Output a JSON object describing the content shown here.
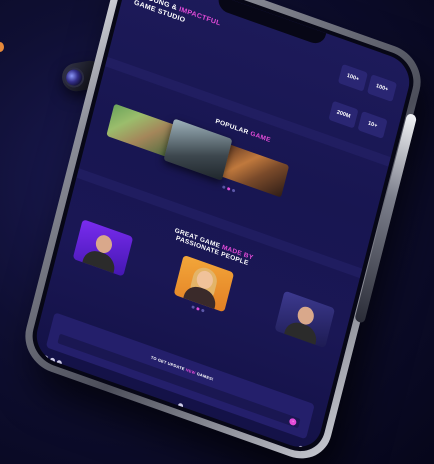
{
  "hero": {
    "title_line1_prefix": "A YOUNG & ",
    "title_line1_accent": "IMPACTFUL",
    "title_line2": "GAME STUDIO",
    "stats": [
      {
        "value": "100+"
      },
      {
        "value": "100+"
      },
      {
        "value": "200M"
      },
      {
        "value": "10+"
      }
    ]
  },
  "popular": {
    "title_prefix": "POPULAR ",
    "title_accent": "GAME"
  },
  "team": {
    "title_line1_prefix": "GREAT GAME ",
    "title_line1_accent": "MADE BY",
    "title_line2": "PASSIONATE PEOPLE"
  },
  "newsletter": {
    "title_prefix": "TO GET UPDATE ",
    "title_accent": "NEW",
    "title_suffix": " GAMES!"
  },
  "colors": {
    "accent": "#e24bd8",
    "background": "#1b1858",
    "card": "#2a2673"
  },
  "icons": {
    "camera": "camera-lens-icon",
    "social": [
      "facebook-icon",
      "twitter-icon",
      "instagram-icon"
    ],
    "phone": "phone-icon",
    "mail": "mail-icon",
    "send": "send-icon"
  }
}
